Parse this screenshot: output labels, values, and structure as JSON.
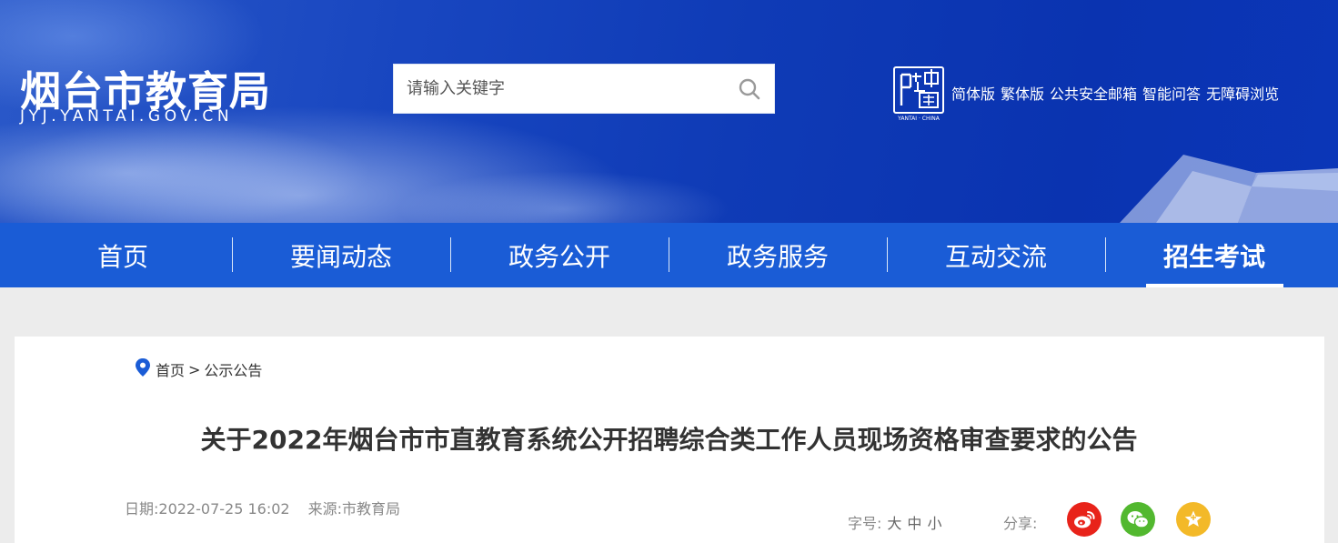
{
  "header": {
    "logo_cn": "烟台市教育局",
    "logo_en": "JYJ.YANTAI.GOV.CN",
    "emblem_label": "YANTAI · CHINA",
    "search": {
      "placeholder": "请输入关键字",
      "value": ""
    },
    "links": [
      "简体版",
      "繁体版",
      "公共安全邮箱",
      "智能问答",
      "无障碍浏览"
    ]
  },
  "nav": {
    "items": [
      "首页",
      "要闻动态",
      "政务公开",
      "政务服务",
      "互动交流",
      "招生考试"
    ],
    "active": "招生考试"
  },
  "breadcrumb": {
    "home": "首页",
    "sep": ">",
    "current": "公示公告"
  },
  "article": {
    "title": "关于2022年烟台市市直教育系统公开招聘综合类工作人员现场资格审查要求的公告",
    "date": "日期:2022-07-25 16:02",
    "source": "来源:市教育局"
  },
  "font_size": {
    "label": "字号:",
    "options": [
      "大",
      "中",
      "小"
    ]
  },
  "share": {
    "label": "分享:",
    "targets": [
      {
        "name": "weibo",
        "icon": "weibo-icon",
        "color": "#e8231a"
      },
      {
        "name": "wechat",
        "icon": "wechat-icon",
        "color": "#52b82f"
      },
      {
        "name": "favorite",
        "icon": "star-icon",
        "color": "#f3b928"
      }
    ]
  },
  "colors": {
    "header_blue": "#0f3bb6",
    "nav_blue": "#1a5cd6",
    "page_bg": "#ececec"
  }
}
